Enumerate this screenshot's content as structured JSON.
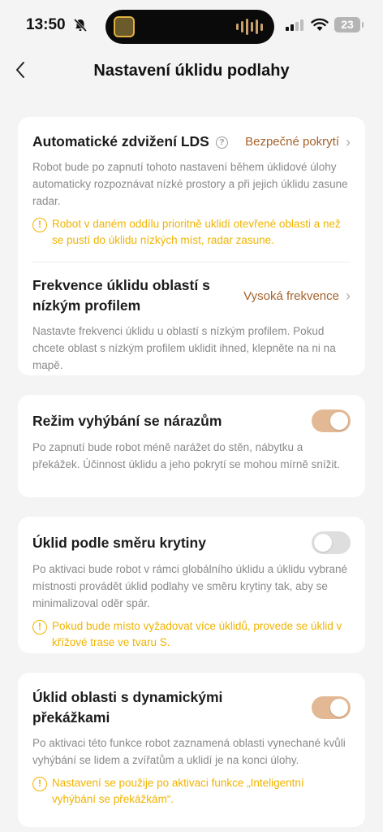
{
  "status": {
    "time": "13:50",
    "battery": "23"
  },
  "header": {
    "title": "Nastavení úklidu podlahy"
  },
  "lds": {
    "title": "Automatické zdvižení LDS",
    "value": "Bezpečné pokrytí",
    "desc": "Robot bude po zapnutí tohoto nastavení během úklidové úlohy automaticky rozpoznávat nízké prostory a při jejich úklidu zasune radar.",
    "warning": "Robot v daném oddílu prioritně uklidí otevřené oblasti a než se pustí do úklidu nízkých míst, radar zasune."
  },
  "frequency": {
    "title": "Frekvence úklidu oblastí s nízkým profilem",
    "value": "Vysoká frekvence",
    "desc": "Nastavte frekvenci úklidu u oblastí s nízkým profilem. Pokud chcete oblast s nízkým profilem uklidit ihned, klepněte na ni na mapě."
  },
  "collision": {
    "title": "Režim vyhýbání se nárazům",
    "enabled": true,
    "desc": "Po zapnutí bude robot méně narážet do stěn, nábytku a překážek. Účinnost úklidu a jeho pokrytí se mohou mírně snížit."
  },
  "floor_direction": {
    "title": "Úklid podle směru krytiny",
    "enabled": false,
    "desc": "Po aktivaci bude robot v rámci globálního úklidu a úklidu vybrané místnosti provádět úklid podlahy ve směru krytiny tak, aby se minimalizoval oděr spár.",
    "warning": "Pokud bude místo vyžadovat více úklidů, provede se úklid v křížové trase ve tvaru S."
  },
  "dynamic_obstacles": {
    "title": "Úklid oblasti s dynamickými překážkami",
    "enabled": true,
    "desc": "Po aktivaci této funkce robot zaznamená oblasti vynechané kvůli vyhýbání se lidem a zvířatům a uklidí je na konci úlohy.",
    "warning": "Nastavení se použije po aktivaci funkce „Inteligentní vyhýbání se překážkám“."
  },
  "colors": {
    "accent": "#a5632c",
    "toggle_on": "#e2b994",
    "toggle_off": "#dedede",
    "warning": "#f0b400",
    "background": "#f4f4f4"
  },
  "icons": {
    "back": "chevron-left-icon",
    "help": "question-circle-icon",
    "warning": "exclamation-circle-icon",
    "chevron": "chevron-right-icon",
    "bell_off": "bell-slash-icon"
  }
}
